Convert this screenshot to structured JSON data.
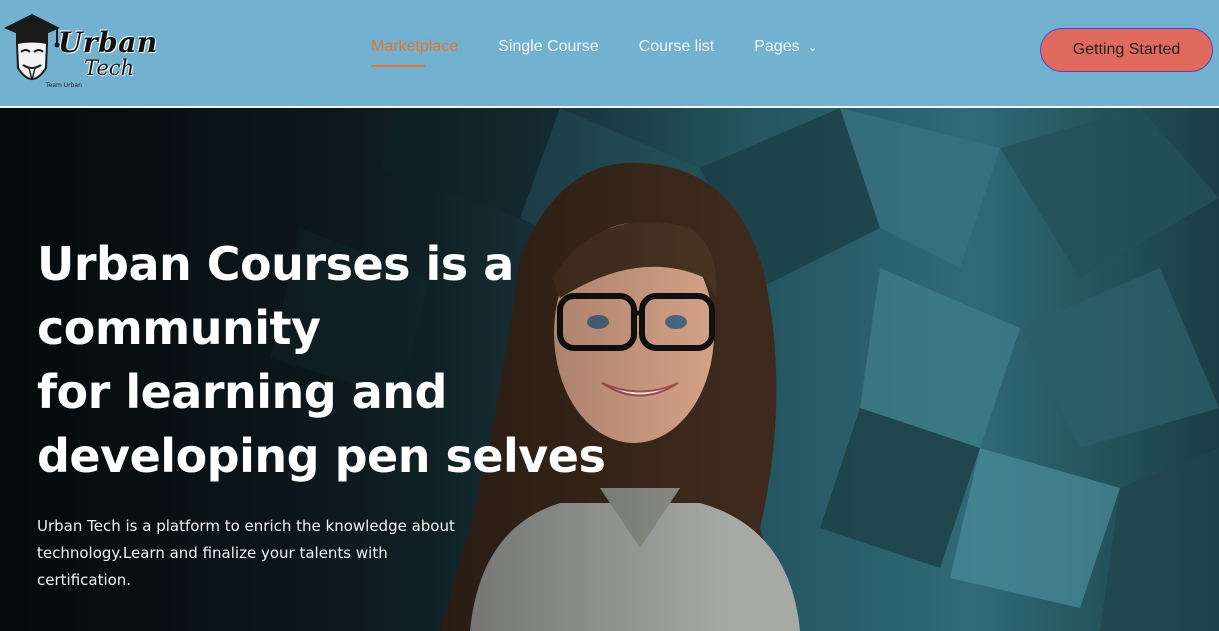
{
  "header": {
    "logo": {
      "title": "Urban",
      "subtitle": "Tech",
      "tagline": "Team Urban"
    },
    "nav": [
      {
        "label": "Marketplace",
        "active": true
      },
      {
        "label": "Single Course",
        "active": false
      },
      {
        "label": "Course list",
        "active": false
      },
      {
        "label": "Pages",
        "active": false,
        "icon": "chevron-down-icon"
      }
    ],
    "cta_label": "Getting Started"
  },
  "hero": {
    "headline_lines": [
      "Urban Courses is a",
      "community",
      "for learning and",
      "developing pen selves"
    ],
    "description_lines": [
      "Urban Tech is a platform to enrich the knowledge about",
      "technology.Learn and finalize your talents with",
      "certification."
    ]
  },
  "colors": {
    "header_bg": "#72b1cf",
    "accent": "#e8732f",
    "cta_bg": "#e06a5c",
    "cta_border": "#5b3dc9"
  }
}
